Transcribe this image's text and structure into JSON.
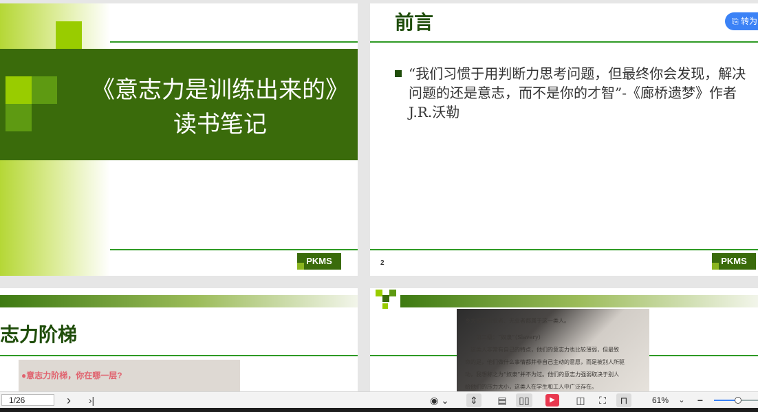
{
  "slides": {
    "s1": {
      "title_line1": "《意志力是训练出来的》",
      "title_line2": "读书笔记",
      "badge": "PKMS"
    },
    "s2": {
      "heading": "前言",
      "quote": "“我们习惯于用判断力思考问题，但最终你会发现，解决问题的还是意志，而不是你的才智”-《廊桥遗梦》作者J.R.沃勒",
      "page_number": "2",
      "badge": "PKMS",
      "convert_button": "转为"
    },
    "s3": {
      "heading": "志力阶梯",
      "photo_text": "●意志力阶梯，你在哪一层?"
    },
    "s4": {
      "photo_lines": [
        "乡大败的职业者、无业者都属于这一类人。",
        "第二级：“奴隶”（Slavery）",
        "这类人非常有自己的特点，他们的意志力也比较薄弱，但最致",
        "命的是，他们做什么事情都并非自己主动的意愿，而是被别人所驱",
        "动，我想称之为“奴隶”并不为过。他们的意志力强弱取决于别人",
        "给他们的压力大小，这类人在学生和工人中广泛存在。"
      ]
    }
  },
  "toolbar": {
    "page_indicator": "1/26",
    "next_icon": "›",
    "last_icon": "›|",
    "zoom": "61%"
  },
  "colors": {
    "dark_green": "#3a6b0b",
    "line_green": "#2e9a24",
    "accent_blue": "#3b82f6"
  }
}
